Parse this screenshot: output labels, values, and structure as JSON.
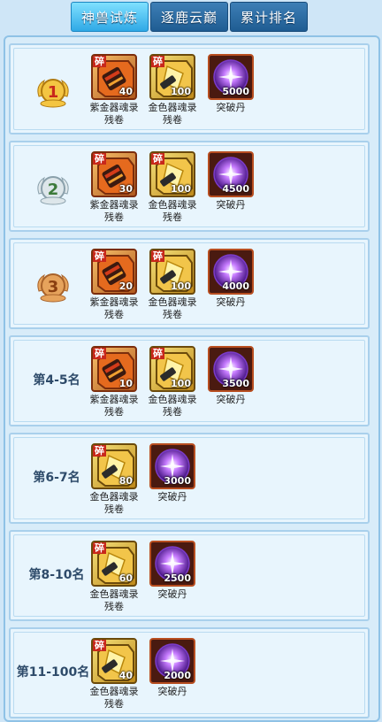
{
  "tabs": [
    {
      "label": "神兽试炼",
      "active": true
    },
    {
      "label": "逐鹿云巅",
      "active": false
    },
    {
      "label": "累计排名",
      "active": false
    }
  ],
  "icons": {
    "fragment_badge": "碎",
    "purple_scroll": "purple-soul-scroll-icon",
    "gold_scroll": "gold-soul-scroll-icon",
    "breakthrough_pill": "purple-orb-icon"
  },
  "rewards": [
    {
      "rank": "",
      "medal": "gold-1",
      "items": [
        {
          "type": "purple",
          "qty": "40",
          "name": "紫金器魂录残卷"
        },
        {
          "type": "gold",
          "qty": "100",
          "name": "金色器魂录残卷"
        },
        {
          "type": "orb",
          "qty": "5000",
          "name": "突破丹"
        }
      ]
    },
    {
      "rank": "",
      "medal": "silver-2",
      "items": [
        {
          "type": "purple",
          "qty": "30",
          "name": "紫金器魂录残卷"
        },
        {
          "type": "gold",
          "qty": "100",
          "name": "金色器魂录残卷"
        },
        {
          "type": "orb",
          "qty": "4500",
          "name": "突破丹"
        }
      ]
    },
    {
      "rank": "",
      "medal": "bronze-3",
      "items": [
        {
          "type": "purple",
          "qty": "20",
          "name": "紫金器魂录残卷"
        },
        {
          "type": "gold",
          "qty": "100",
          "name": "金色器魂录残卷"
        },
        {
          "type": "orb",
          "qty": "4000",
          "name": "突破丹"
        }
      ]
    },
    {
      "rank": "第4-5名",
      "items": [
        {
          "type": "purple",
          "qty": "10",
          "name": "紫金器魂录残卷"
        },
        {
          "type": "gold",
          "qty": "100",
          "name": "金色器魂录残卷"
        },
        {
          "type": "orb",
          "qty": "3500",
          "name": "突破丹"
        }
      ]
    },
    {
      "rank": "第6-7名",
      "items": [
        {
          "type": "gold",
          "qty": "80",
          "name": "金色器魂录残卷"
        },
        {
          "type": "orb",
          "qty": "3000",
          "name": "突破丹"
        }
      ]
    },
    {
      "rank": "第8-10名",
      "items": [
        {
          "type": "gold",
          "qty": "60",
          "name": "金色器魂录残卷"
        },
        {
          "type": "orb",
          "qty": "2500",
          "name": "突破丹"
        }
      ]
    },
    {
      "rank": "第11-100名",
      "items": [
        {
          "type": "gold",
          "qty": "40",
          "name": "金色器魂录残卷"
        },
        {
          "type": "orb",
          "qty": "2000",
          "name": "突破丹"
        }
      ]
    }
  ],
  "colors": {
    "tab_active": "#2fa9e6",
    "tab_inactive": "#1f5c92",
    "row_bg": "#e8f5fd"
  }
}
